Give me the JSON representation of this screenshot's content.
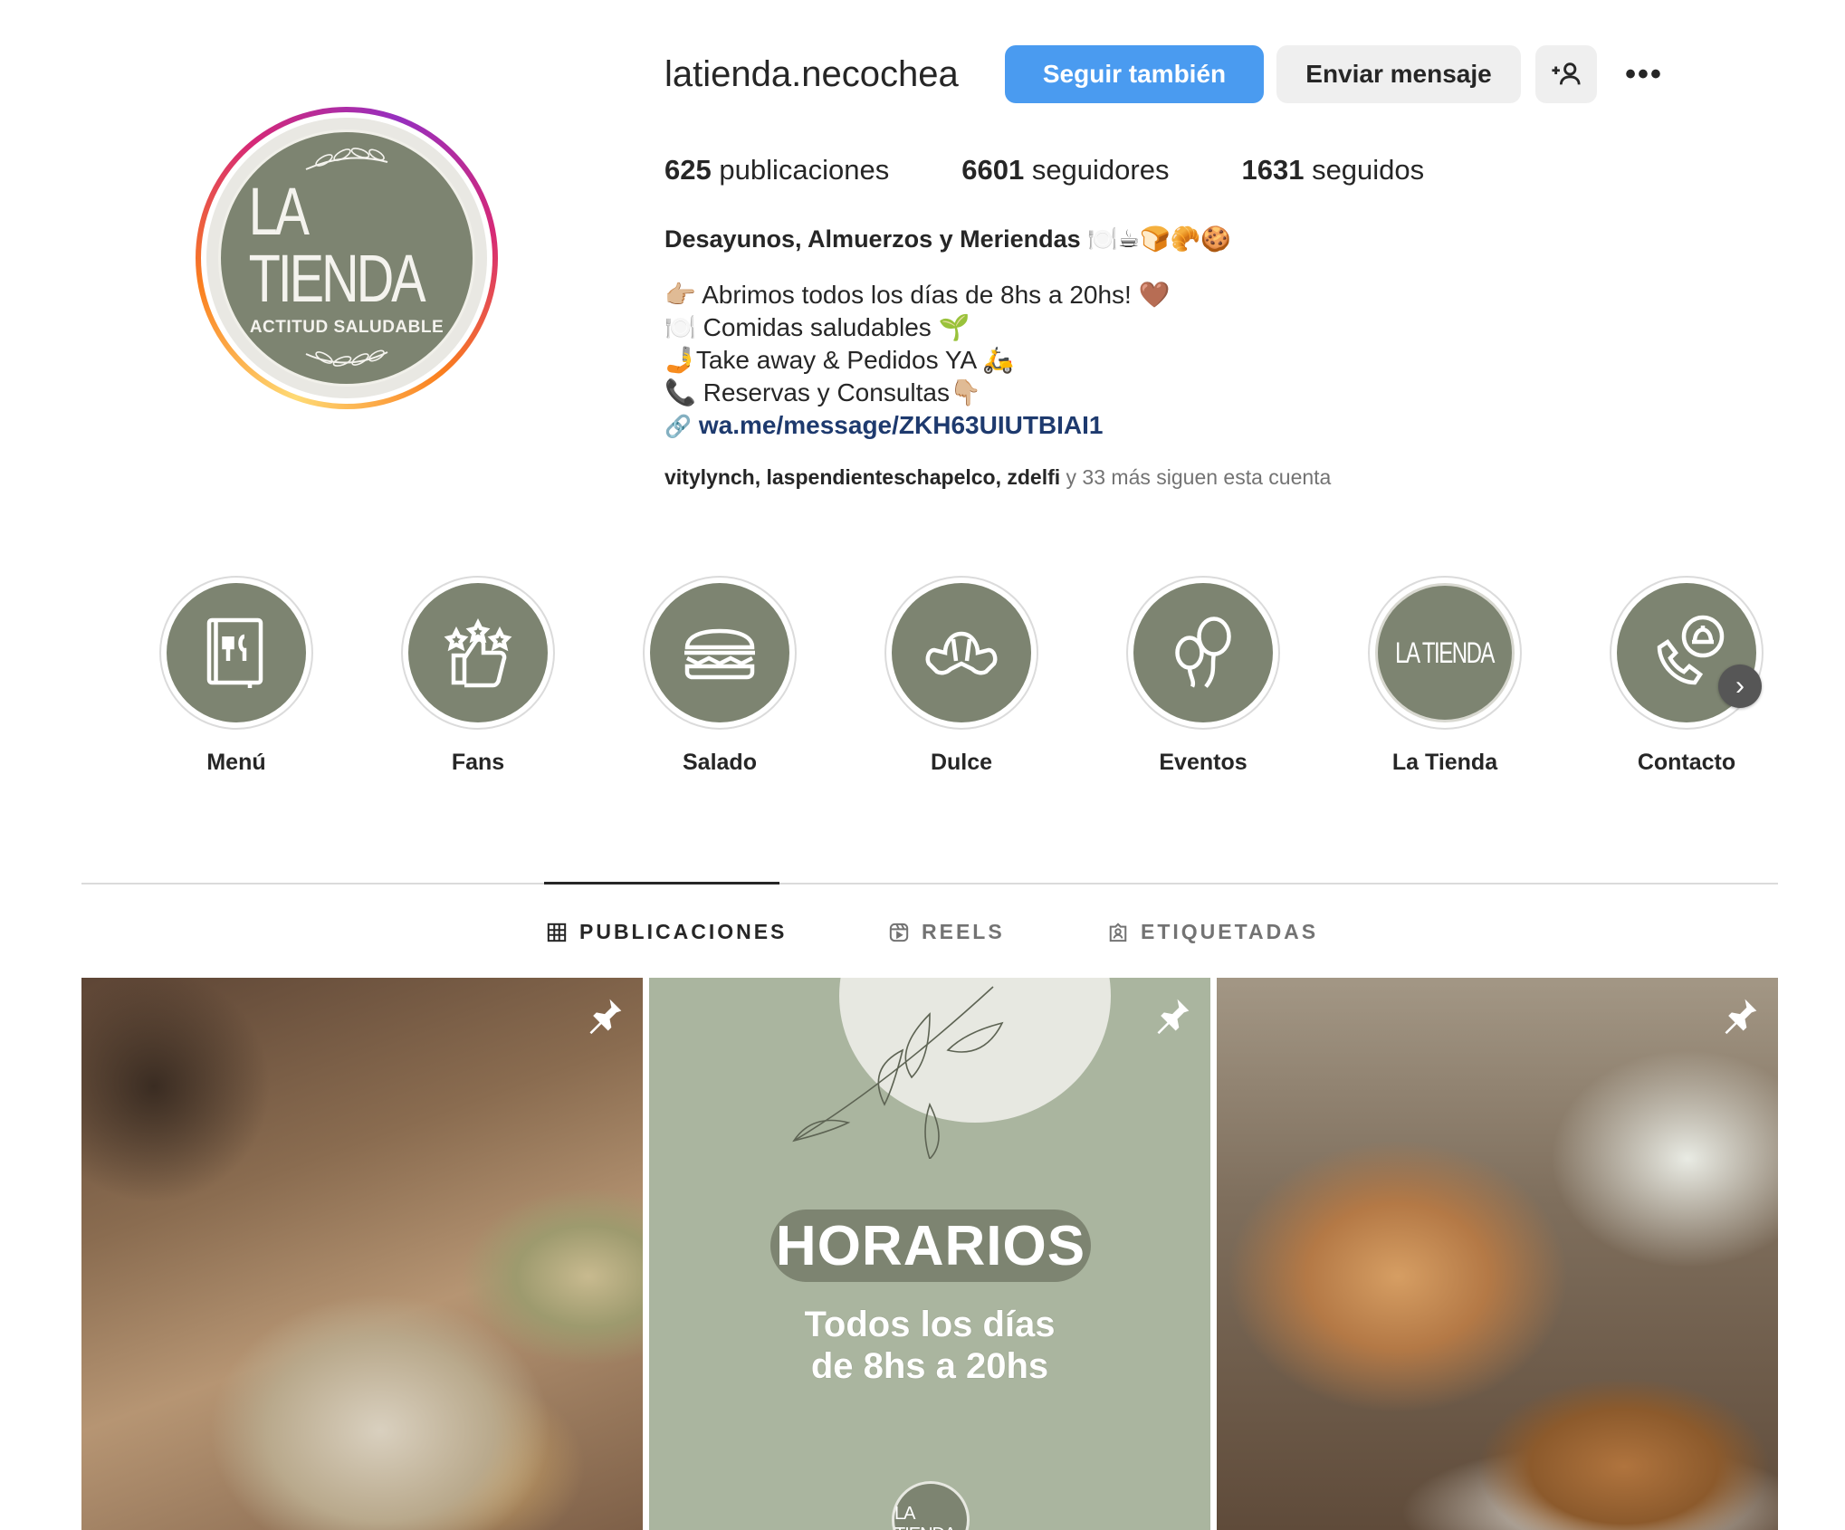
{
  "profile": {
    "username": "latienda.necochea",
    "avatar": {
      "brand": "LA TIENDA",
      "tagline": "ACTITUD SALUDABLE"
    },
    "buttons": {
      "follow": "Seguir también",
      "message": "Enviar mensaje",
      "add_user_icon": "add-person-icon",
      "more": "•••"
    },
    "stats": [
      {
        "num": "625",
        "label": "publicaciones"
      },
      {
        "num": "6601",
        "label": "seguidores"
      },
      {
        "num": "1631",
        "label": "seguidos"
      }
    ],
    "bio": {
      "title": "Desayunos, Almuerzos y Meriendas 🍽️☕🍞🥐🍪",
      "lines": [
        "👉🏼 Abrimos todos los días de 8hs a 20hs! 🤎",
        "🍽️ Comidas saludables 🌱",
        "🤳Take away & Pedidos YA 🛵",
        "📞 Reservas y Consultas👇🏼"
      ],
      "link": "wa.me/message/ZKH63UIUTBIAI1"
    },
    "followed_by": {
      "names": [
        "vitylynch",
        "laspendienteschapelco",
        "zdelfi"
      ],
      "suffix": " y 33 más siguen esta cuenta"
    }
  },
  "highlights": [
    {
      "label": "Menú",
      "icon": "menu-book-icon"
    },
    {
      "label": "Fans",
      "icon": "thumbs-up-stars-icon"
    },
    {
      "label": "Salado",
      "icon": "sandwich-icon"
    },
    {
      "label": "Dulce",
      "icon": "croissant-icon"
    },
    {
      "label": "Eventos",
      "icon": "balloons-icon"
    },
    {
      "label": "La Tienda",
      "icon": "logo-icon"
    },
    {
      "label": "Contacto",
      "icon": "phone-bell-icon"
    }
  ],
  "tabs": [
    {
      "label": "PUBLICACIONES",
      "icon": "grid-icon",
      "active": true
    },
    {
      "label": "REELS",
      "icon": "reels-icon",
      "active": false
    },
    {
      "label": "ETIQUETADAS",
      "icon": "tagged-icon",
      "active": false
    }
  ],
  "posts": [
    {
      "pinned": true,
      "alt": "food"
    },
    {
      "pinned": true,
      "title": "HORARIOS",
      "subtitle_1": "Todos los días",
      "subtitle_2": "de 8hs a 20hs",
      "logo": "LA TIENDA"
    },
    {
      "pinned": true,
      "alt": "tea"
    }
  ],
  "colors": {
    "accent": "#4a9bf0",
    "brand_green": "#7d8471",
    "post_green": "#aab59f"
  }
}
